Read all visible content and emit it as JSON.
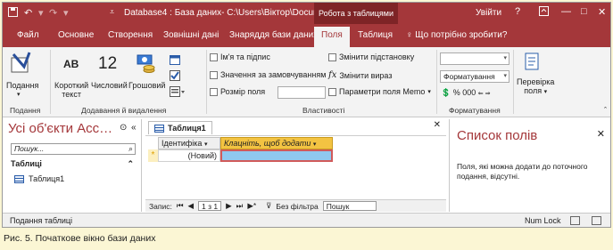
{
  "titlebar": {
    "doc_title": "Database4 : База даних- C:\\Users\\Віктор\\Docume…",
    "context_tab": "Робота з таблицями",
    "signin": "Увійти",
    "help": "?",
    "minimize": "—",
    "maximize": "□",
    "close": "✕"
  },
  "tabs": [
    "Файл",
    "Основне",
    "Створення",
    "Зовнішні дані",
    "Знаряддя бази даних",
    "Поля",
    "Таблиця"
  ],
  "tellme": "Що потрібно зробити?",
  "ribbon": {
    "view_label_1": "Подання",
    "view_label_2": "",
    "short_text_icon": "AB",
    "short_text_1": "Короткий",
    "short_text_2": "текст",
    "number_icon": "12",
    "number_label": "Числовий",
    "currency_label": "Грошовий",
    "group_views": "Подання",
    "group_add_delete": "Додавання й видалення",
    "name_caption": "Ім'я та підпис",
    "default_value": "Значення за замовчуванням",
    "field_size": "Розмір поля",
    "modify_lookups": "Змінити підстановку",
    "modify_expression": "Змінити вираз",
    "memo_settings": "Параметри поля Memo",
    "group_properties": "Властивості",
    "format_combo": "Форматування",
    "format_symbols": "% 000 ",
    "group_formatting": "Форматування",
    "validation_1": "Перевірка",
    "validation_2": "поля"
  },
  "nav": {
    "title": "Усі об'єкти Acc…",
    "search_placeholder": "Пошук...",
    "header": "Таблиці",
    "item": "Таблиця1"
  },
  "datasheet": {
    "tab_label": "Таблиця1",
    "col1": "Ідентифіка",
    "col2": "Клацніть, щоб додати",
    "new_row_marker": "*",
    "cell_new": "(Новий)",
    "rec_label": "Запис:",
    "rec_pos": "1 з 1",
    "no_filter": "Без фільтра",
    "search": "Пошук"
  },
  "fieldlist": {
    "title": "Список полів",
    "text": "Поля, які можна додати до поточного подання, відсутні."
  },
  "status": {
    "left": "Подання таблиці",
    "numlock": "Num Lock"
  },
  "caption": "Рис. 5. Початкове вікно бази даних",
  "colors": {
    "accent": "#a4373a",
    "header_sel": "#f3c342",
    "cell_sel": "#8fc8f0"
  }
}
